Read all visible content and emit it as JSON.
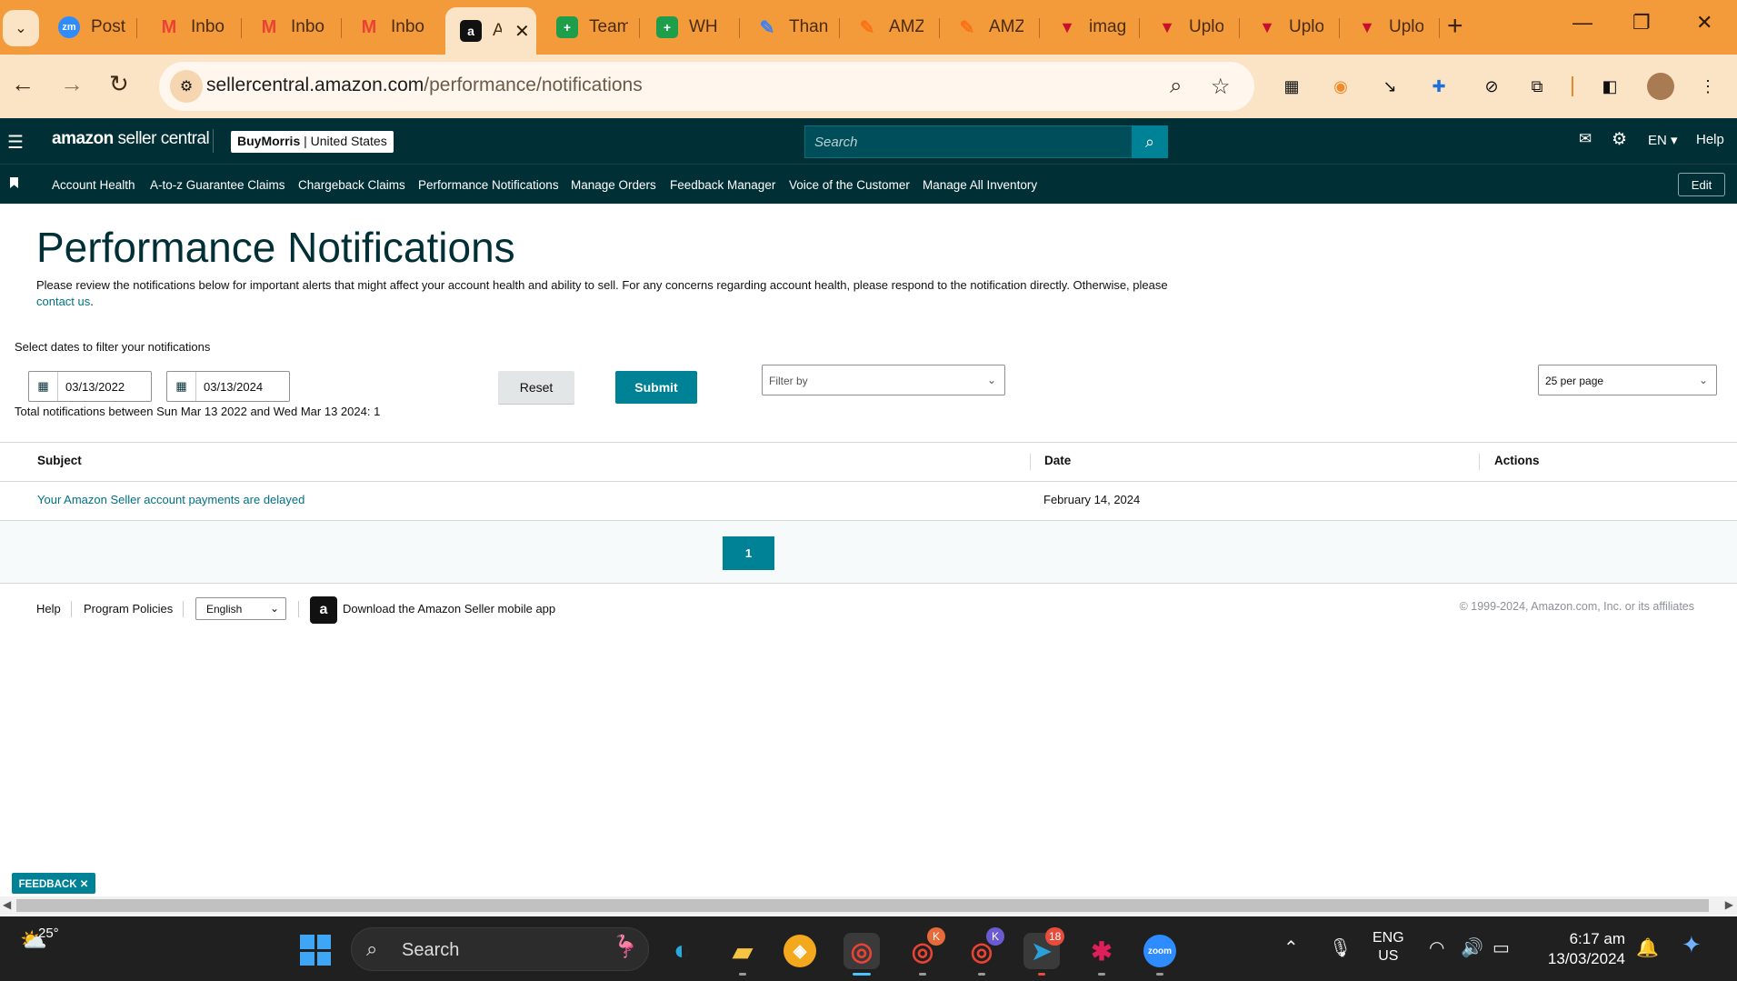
{
  "browser": {
    "tabs": [
      {
        "label": "Post",
        "icon": "zoom-icon",
        "color": "#2d8cff",
        "glyph": "zm"
      },
      {
        "label": "Inbo",
        "icon": "gmail-icon",
        "color": "#ea4335",
        "glyph": "M"
      },
      {
        "label": "Inbo",
        "icon": "gmail-icon",
        "color": "#ea4335",
        "glyph": "M"
      },
      {
        "label": "Inbo",
        "icon": "gmail-icon",
        "color": "#ea4335",
        "glyph": "M"
      },
      {
        "label": "A",
        "icon": "amazon-icon",
        "color": "#111111",
        "glyph": "a",
        "active": true
      },
      {
        "label": "Team",
        "icon": "sheets-plus-icon",
        "color": "#1e9e4a",
        "glyph": "+"
      },
      {
        "label": "WH I",
        "icon": "sheets-plus-icon",
        "color": "#1e9e4a",
        "glyph": "+"
      },
      {
        "label": "Than",
        "icon": "pen-icon",
        "color": "#3b82f6",
        "glyph": "✎"
      },
      {
        "label": "AMZ",
        "icon": "pen-icon",
        "color": "#f97316",
        "glyph": "✎"
      },
      {
        "label": "AMZ",
        "icon": "pen-icon",
        "color": "#f97316",
        "glyph": "✎"
      },
      {
        "label": "imag",
        "icon": "shield-logo-icon",
        "color": "#c8102e",
        "glyph": "▼"
      },
      {
        "label": "Uplo",
        "icon": "shield-logo-icon",
        "color": "#c8102e",
        "glyph": "▼"
      },
      {
        "label": "Uplo",
        "icon": "shield-logo-icon",
        "color": "#c8102e",
        "glyph": "▼"
      },
      {
        "label": "Uplo",
        "icon": "shield-logo-icon",
        "color": "#c8102e",
        "glyph": "▼"
      }
    ],
    "url_host": "sellercentral.amazon.com",
    "url_path": "/performance/notifications"
  },
  "header": {
    "logo_bold": "amazon",
    "logo_light": " seller central",
    "store_name": "BuyMorris",
    "store_region": " | United States",
    "search_placeholder": "Search",
    "lang": "EN ▾",
    "help": "Help"
  },
  "nav": {
    "items": [
      "Account Health",
      "A-to-z Guarantee Claims",
      "Chargeback Claims",
      "Performance Notifications",
      "Manage Orders",
      "Feedback Manager",
      "Voice of the Customer",
      "Manage All Inventory"
    ],
    "edit": "Edit"
  },
  "main": {
    "title": "Performance Notifications",
    "intro": "Please review the notifications below for important alerts that might affect your account health and ability to sell. For any concerns regarding account health, please respond to the notification directly. Otherwise, please ",
    "contact_link": "contact us",
    "intro_end": ".",
    "filter_label": "Select dates to filter your notifications",
    "start_date": "03/13/2022",
    "end_date": "03/13/2024",
    "reset": "Reset",
    "submit": "Submit",
    "filter_by": "Filter by",
    "per_page": "25 per page",
    "total": "Total notifications between Sun Mar 13 2022 and Wed Mar 13 2024: 1"
  },
  "table": {
    "columns": [
      "Subject",
      "Date",
      "Actions"
    ],
    "rows": [
      {
        "subject": "Your Amazon Seller account payments are delayed",
        "date": "February 14, 2024",
        "actions": ""
      }
    ],
    "page": "1"
  },
  "footer": {
    "help": "Help",
    "policies": "Program Policies",
    "language": "English",
    "app_link": "Download the Amazon Seller mobile app",
    "copyright": "© 1999-2024, Amazon.com, Inc. or its affiliates"
  },
  "feedback": "FEEDBACK ✕",
  "taskbar": {
    "temperature": "25°",
    "search": "Search",
    "telegram_badge": "18",
    "chrome_k_badge": "K",
    "lang_top": "ENG",
    "lang_bottom": "US",
    "time": "6:17 am",
    "date": "13/03/2024"
  },
  "colors": {
    "browser_frame": "#f39a3a",
    "seller_header": "#002f36",
    "accent_teal": "#008296",
    "link": "#007185"
  }
}
